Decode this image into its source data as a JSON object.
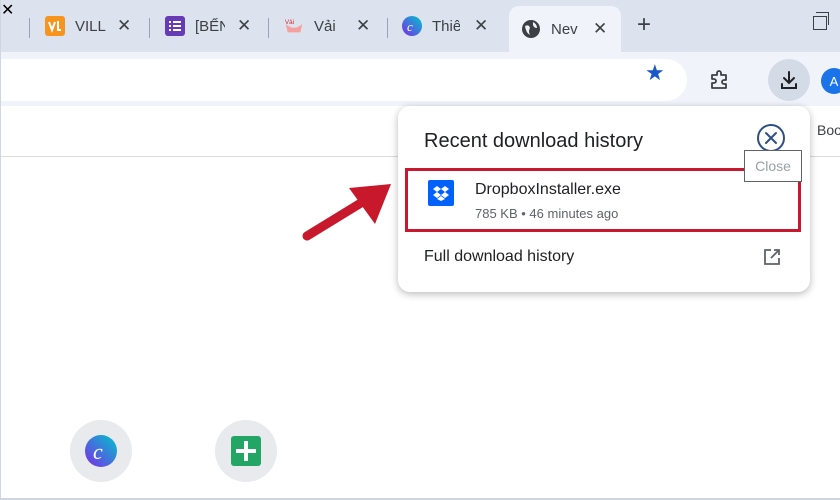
{
  "tabs": [
    {
      "title": "VILL",
      "favicon": "vilt-logo"
    },
    {
      "title": "[BẾN",
      "favicon": "list-icon"
    },
    {
      "title": "Vải",
      "favicon": "shop-icon"
    },
    {
      "title": "Thiê",
      "favicon": "canva-icon"
    },
    {
      "title": "Nev",
      "favicon": "globe-icon"
    }
  ],
  "bookmarks_bar": {
    "text": "Boo"
  },
  "avatar": {
    "letter": "A"
  },
  "popup": {
    "title": "Recent download history",
    "close_tooltip": "Close",
    "item": {
      "file_name": "DropboxInstaller.exe",
      "meta": "785 KB • 46 minutes ago"
    },
    "full_history_label": "Full download history"
  },
  "colors": {
    "accent": "#1a57c9",
    "highlight": "#c8192c",
    "dropbox": "#0061fe",
    "sheets_green": "#23a566"
  }
}
